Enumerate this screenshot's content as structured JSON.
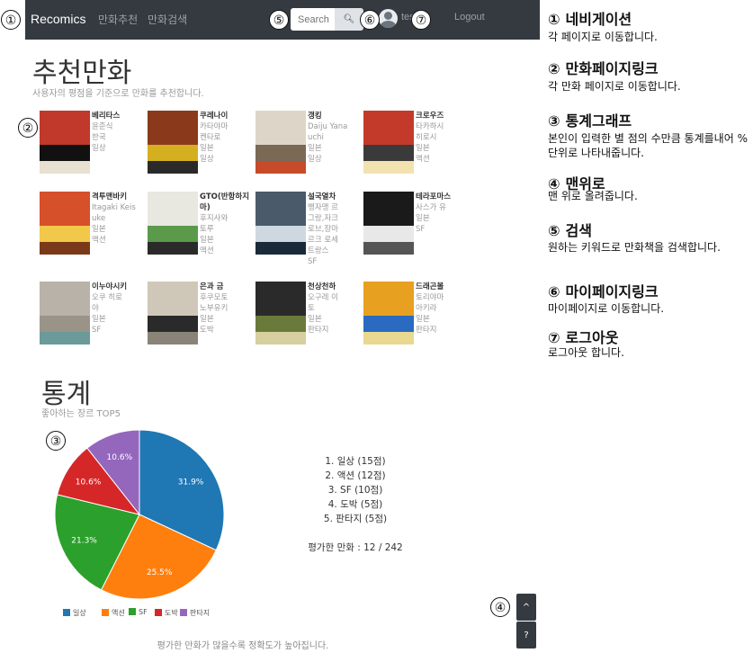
{
  "nav": {
    "brand": "Recomics",
    "links": [
      "만화추천",
      "만화검색"
    ],
    "search_placeholder": "Search",
    "user": "test",
    "logout": "Logout"
  },
  "callouts": [
    "①",
    "②",
    "③",
    "④",
    "⑤",
    "⑥",
    "⑦"
  ],
  "recommend": {
    "title": "추천만화",
    "subtitle": "사용자의 평점을 기준으로 만화를 추천합니다.",
    "items": [
      {
        "title": "베리타스",
        "lines": [
          "윤준식",
          "한국",
          "일상"
        ],
        "colors": [
          "#c0392b",
          "#111111",
          "#e8e0d0"
        ]
      },
      {
        "title": "쿠레나이",
        "lines": [
          "카타야마",
          "켄타로",
          "일본",
          "일상"
        ],
        "colors": [
          "#8a3a1a",
          "#d4b020",
          "#2a2a2a"
        ]
      },
      {
        "title": "갱킹",
        "lines": [
          "Daiju Yana",
          "uchi",
          "일본",
          "일상"
        ],
        "colors": [
          "#ddd6c8",
          "#7a6a55",
          "#c74a2a"
        ]
      },
      {
        "title": "크로우즈",
        "lines": [
          "타카하시",
          "히로시",
          "일본",
          "액션"
        ],
        "colors": [
          "#c43a2a",
          "#3a3a3a",
          "#f2e2b0"
        ]
      },
      {
        "title": "격투맨바키",
        "lines": [
          "Itagaki Keis",
          "uke",
          "일본",
          "액션"
        ],
        "colors": [
          "#d6502a",
          "#f2c84a",
          "#7a3a1a"
        ]
      },
      {
        "title": "GTO(반항하지마)",
        "lines": [
          "후지사와",
          "토루",
          "일본",
          "액션"
        ],
        "colors": [
          "#e8e8e0",
          "#5a9a4a",
          "#2a2a2a"
        ]
      },
      {
        "title": "설국열차",
        "lines": [
          "뱅자맹 르",
          "그랑,자크",
          "로브,장마",
          "르크 로세",
          "트랑스",
          "SF"
        ],
        "colors": [
          "#4a5a6a",
          "#cfd8e0",
          "#1a2a3a"
        ]
      },
      {
        "title": "테라포마스",
        "lines": [
          "사스가 유",
          "일본",
          "SF"
        ],
        "colors": [
          "#1a1a1a",
          "#e8e8e8",
          "#555555"
        ]
      },
      {
        "title": "이누야시키",
        "lines": [
          "오쿠 히로",
          "야",
          "일본",
          "SF"
        ],
        "colors": [
          "#b8b2a8",
          "#9a9488",
          "#6a9a9a"
        ]
      },
      {
        "title": "은과 금",
        "lines": [
          "후쿠모토",
          "노부유키",
          "일본",
          "도박"
        ],
        "colors": [
          "#cfc8b8",
          "#2a2a2a",
          "#8a8478"
        ]
      },
      {
        "title": "천상천하",
        "lines": [
          "오구레 이",
          "토",
          "일본",
          "판타지"
        ],
        "colors": [
          "#2a2a2a",
          "#6a7a3a",
          "#d6d0a0"
        ]
      },
      {
        "title": "드래곤볼",
        "lines": [
          "토리야마",
          "아키라",
          "일본",
          "판타지"
        ],
        "colors": [
          "#e8a020",
          "#2a6ac0",
          "#e8d890"
        ]
      }
    ]
  },
  "stats": {
    "title": "통계",
    "subtitle": "좋아하는 장르 TOP5",
    "ranking": [
      "1. 일상 (15점)",
      "2. 액션 (12점)",
      "3. SF (10점)",
      "4. 도박 (5점)",
      "5. 판타지 (5점)"
    ],
    "rated": "평가한 만화 : 12 / 242",
    "footer": "평가한 만화가 많을수록 정확도가 높아집니다."
  },
  "chart_data": {
    "type": "pie",
    "categories": [
      "일상",
      "액션",
      "SF",
      "도박",
      "판타지"
    ],
    "values": [
      31.9,
      25.5,
      21.3,
      10.6,
      10.6
    ],
    "value_labels": [
      "31.9%",
      "25.5%",
      "21.3%",
      "10.6%",
      "10.6%"
    ],
    "colors": [
      "#1f77b4",
      "#ff7f0e",
      "#2ca02c",
      "#d62728",
      "#9467bd"
    ],
    "legend_position": "bottom"
  },
  "buttons": {
    "top": "^",
    "help": "?"
  },
  "annotations": [
    {
      "num": "①",
      "title": "네비게이션",
      "desc": "각 페이지로 이동합니다."
    },
    {
      "num": "②",
      "title": "만화페이지링크",
      "desc": "각 만화 페이지로 이동합니다."
    },
    {
      "num": "③",
      "title": "통계그래프",
      "desc": "본인이 입력한 별 점의 수만큼 통계를내어 %단위로 나타내줍니다."
    },
    {
      "num": "④",
      "title": "맨위로",
      "desc": "맨 위로 올려줍니다."
    },
    {
      "num": "⑤",
      "title": "검색",
      "desc": "원하는 키워드로 만화책을 검색합니다."
    },
    {
      "num": "⑥",
      "title": "마이페이지링크",
      "desc": "마이페이지로 이동합니다."
    },
    {
      "num": "⑦",
      "title": "로그아웃",
      "desc": "로그아웃 합니다."
    }
  ]
}
